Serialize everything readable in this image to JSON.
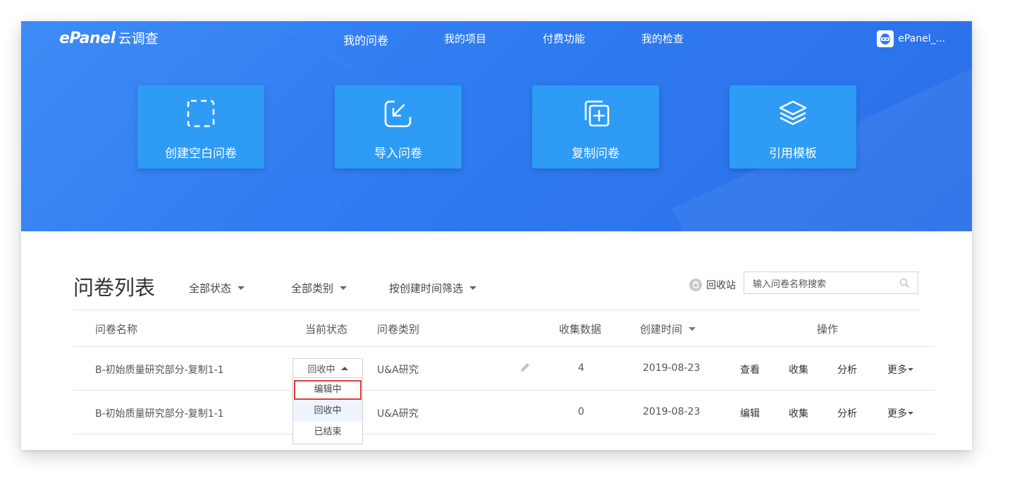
{
  "header": {
    "logo_brand": "ePanel",
    "logo_sub": "云调查",
    "nav": [
      {
        "label": "我的问卷"
      },
      {
        "label": "我的项目"
      },
      {
        "label": "付费功能"
      },
      {
        "label": "我的检查"
      }
    ],
    "user_name": "ePanel_..."
  },
  "actions": [
    {
      "label": "创建空白问卷",
      "icon": "dashed-square-icon"
    },
    {
      "label": "导入问卷",
      "icon": "import-arrow-icon"
    },
    {
      "label": "复制问卷",
      "icon": "copy-plus-icon"
    },
    {
      "label": "引用模板",
      "icon": "layers-icon"
    }
  ],
  "list": {
    "title": "问卷列表",
    "filters": [
      "全部状态",
      "全部类别",
      "按创建时间筛选"
    ],
    "recycle_label": "回收站",
    "search_placeholder": "输入问卷名称搜索",
    "columns": [
      "问卷名称",
      "当前状态",
      "问卷类别",
      "收集数据",
      "创建时间",
      "操作"
    ],
    "rows": [
      {
        "name": "B-初始质量研究部分-复制1-1",
        "status": "回收中",
        "category": "U&A研究",
        "count": "4",
        "date": "2019-08-23",
        "actions": [
          "查看",
          "收集",
          "分析",
          "更多"
        ]
      },
      {
        "name": "B-初始质量研究部分-复制1-1",
        "status": "回收中",
        "category": "U&A研究",
        "count": "0",
        "date": "2019-08-23",
        "actions": [
          "编辑",
          "收集",
          "分析",
          "更多"
        ]
      }
    ],
    "status_options": [
      "编辑中",
      "回收中",
      "已结束"
    ]
  },
  "colors": {
    "hero": "#2f7bf0",
    "card": "#2e9bf5",
    "highlight": "#e03b3b"
  }
}
